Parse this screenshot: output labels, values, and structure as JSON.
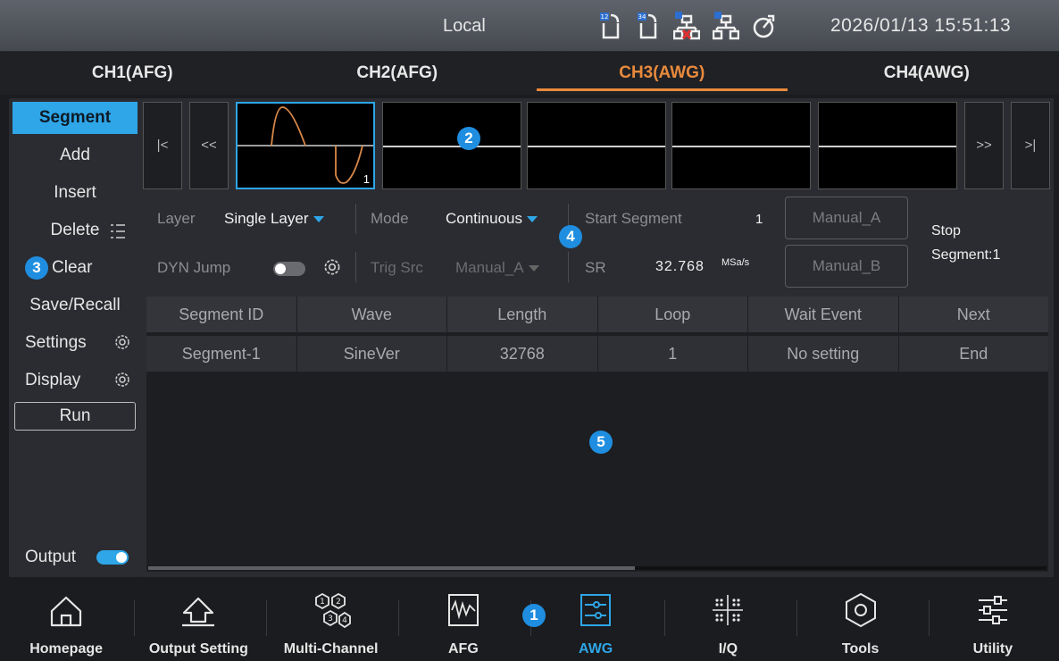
{
  "status": {
    "mode": "Local",
    "datetime": "2026/01/13 15:51:13",
    "icons": [
      "usb-12-icon",
      "usb-34-icon",
      "network-disconnected-icon",
      "network-2-icon",
      "timer-icon"
    ]
  },
  "tabs": [
    {
      "label": "CH1(AFG)"
    },
    {
      "label": "CH2(AFG)"
    },
    {
      "label": "CH3(AWG)"
    },
    {
      "label": "CH4(AWG)"
    }
  ],
  "side_menu": {
    "segment": "Segment",
    "add": "Add",
    "insert": "Insert",
    "delete": "Delete",
    "clear": "Clear",
    "save_recall": "Save/Recall",
    "settings": "Settings",
    "display": "Display",
    "run": "Run",
    "output": "Output"
  },
  "segments": {
    "first": "|<",
    "prev": "<<",
    "next": ">>",
    "last": ">|",
    "selected_index": "1"
  },
  "params": {
    "layer_label": "Layer",
    "layer_value": "Single Layer",
    "mode_label": "Mode",
    "mode_value": "Continuous",
    "start_label": "Start Segment",
    "start_value": "1",
    "manual_a": "Manual_A",
    "manual_b": "Manual_B",
    "stop_label": "Stop",
    "stop_value": "Segment:1",
    "dyn_label": "DYN Jump",
    "trig_label": "Trig Src",
    "trig_value": "Manual_A",
    "sr_label": "SR",
    "sr_value": "32.768",
    "sr_unit": "MSa/s"
  },
  "table": {
    "headers": [
      "Segment ID",
      "Wave",
      "Length",
      "Loop",
      "Wait Event",
      "Next"
    ],
    "rows": [
      [
        "Segment-1",
        "SineVer",
        "32768",
        "1",
        "No setting",
        "End"
      ]
    ]
  },
  "callouts": [
    "1",
    "2",
    "3",
    "4",
    "5"
  ],
  "nav": [
    {
      "label": "Homepage",
      "icon": "home-icon"
    },
    {
      "label": "Output Setting",
      "icon": "output-setting-icon"
    },
    {
      "label": "Multi-Channel",
      "icon": "multi-channel-icon"
    },
    {
      "label": "AFG",
      "icon": "afg-icon"
    },
    {
      "label": "AWG",
      "icon": "awg-icon"
    },
    {
      "label": "I/Q",
      "icon": "iq-icon"
    },
    {
      "label": "Tools",
      "icon": "tools-icon"
    },
    {
      "label": "Utility",
      "icon": "utility-icon"
    }
  ],
  "colors": {
    "accent": "#2ea6e8",
    "active_tab": "#e98a3c",
    "waveform": "#d9894a"
  }
}
